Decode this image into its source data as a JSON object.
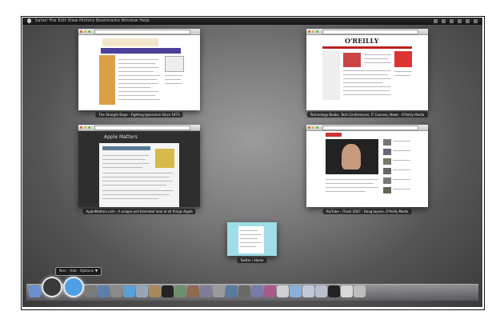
{
  "menubar": {
    "menus": "Safari   File   Edit   View   History   Bookmarks   Window   Help"
  },
  "windows": [
    {
      "id": "w1",
      "caption": "The Straight Dope - Fighting Ignorance Since 1973"
    },
    {
      "id": "w2",
      "caption": "Technology Books, Tech Conferences, IT Courses, News - O'Reilly Media",
      "logo": "O'REILLY"
    },
    {
      "id": "w3",
      "caption": "AppleMatters.com - A unique yet Extended look at all things Apple",
      "masthead": "Apple Matters"
    },
    {
      "id": "w4",
      "caption": "YouTube - iTrack 2007 : Doug Jaynes, O'Reilly Media"
    },
    {
      "id": "w5",
      "caption": "Twitter / Home"
    }
  ],
  "dock": {
    "tooltip": "Nov · Ada · Options  ▼",
    "items": [
      {
        "icon": "finder-icon",
        "color": "#6a8fd0"
      },
      {
        "icon": "dashboard-icon",
        "color": "#3a3a3a"
      },
      {
        "icon": "safari-icon",
        "color": "#4f9fe6"
      },
      {
        "icon": "spotlight-icon",
        "color": "#7a7a7a"
      },
      {
        "icon": "xcode-icon",
        "color": "#5d7fa8"
      },
      {
        "icon": "preview-icon",
        "color": "#8a8a8a"
      },
      {
        "icon": "itunes-icon",
        "color": "#5aa0d8"
      },
      {
        "icon": "folder-icon",
        "color": "#9aa6b8"
      },
      {
        "icon": "photos-icon",
        "color": "#a58a5a"
      },
      {
        "icon": "terminal-icon",
        "color": "#222222"
      },
      {
        "icon": "app-icon",
        "color": "#6f8f6a"
      },
      {
        "icon": "app-icon",
        "color": "#8f6a4f"
      },
      {
        "icon": "app-icon",
        "color": "#7d7d9a"
      },
      {
        "icon": "app-icon",
        "color": "#9a9a9a"
      },
      {
        "icon": "app-icon",
        "color": "#5a7aa0"
      },
      {
        "icon": "app-icon",
        "color": "#6a6a6a"
      },
      {
        "icon": "app-icon",
        "color": "#7a7aa8"
      },
      {
        "icon": "app-icon",
        "color": "#a85a8a"
      },
      {
        "icon": "app-icon",
        "color": "#d0d0d0"
      },
      {
        "icon": "app-icon",
        "color": "#8ab0d8"
      },
      {
        "icon": "app-icon",
        "color": "#c0c8d8"
      },
      {
        "icon": "app-icon",
        "color": "#b8c0d0"
      },
      {
        "icon": "app-icon",
        "color": "#222222"
      },
      {
        "icon": "app-icon",
        "color": "#d8d8d8"
      },
      {
        "icon": "trash-icon",
        "color": "#bdbdbd"
      }
    ]
  }
}
